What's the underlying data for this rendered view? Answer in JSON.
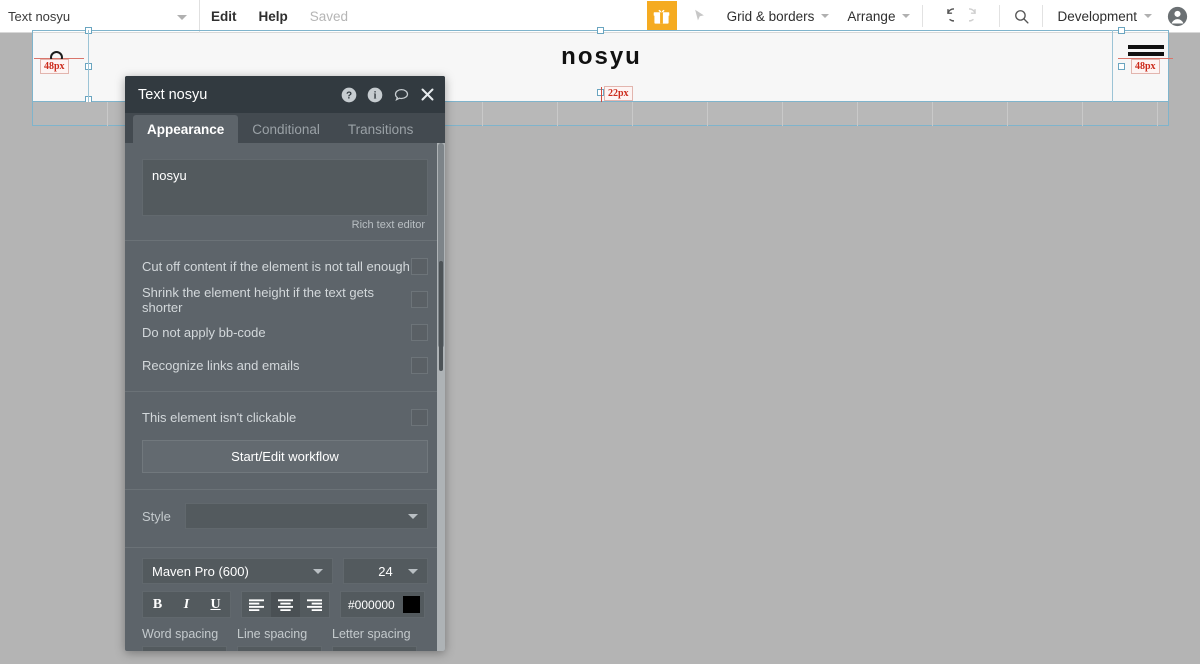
{
  "topbar": {
    "element_selector": {
      "value": "Text nosyu",
      "icon": "chevron-down-icon"
    },
    "menu": [
      {
        "label": "Edit",
        "dim": false
      },
      {
        "label": "Help",
        "dim": false
      },
      {
        "label": "Saved",
        "dim": true
      }
    ],
    "gift_icon": "gift-icon",
    "cursor_icon": "cursor-arrow-icon",
    "grid_borders": {
      "label": "Grid & borders",
      "icon": "chevron-down-icon"
    },
    "arrange": {
      "label": "Arrange",
      "icon": "chevron-down-icon"
    },
    "undo_icon": "undo-icon",
    "redo_icon": "redo-icon",
    "search_icon": "search-icon",
    "version": {
      "label": "Development",
      "icon": "chevron-down-icon"
    },
    "avatar_icon": "user-avatar-icon"
  },
  "canvas": {
    "page_title": "nosyu",
    "measurements": [
      {
        "id": "left",
        "label": "48px"
      },
      {
        "id": "center",
        "label": "22px"
      },
      {
        "id": "right",
        "label": "48px"
      }
    ]
  },
  "panel": {
    "title": "Text nosyu",
    "header_icons": [
      {
        "name": "help-icon",
        "glyph": "?"
      },
      {
        "name": "info-icon",
        "glyph": "i"
      },
      {
        "name": "comment-icon",
        "glyph": "comment"
      },
      {
        "name": "close-icon",
        "glyph": "✕"
      }
    ],
    "tabs": [
      {
        "label": "Appearance",
        "active": true
      },
      {
        "label": "Conditional",
        "active": false
      },
      {
        "label": "Transitions",
        "active": false
      }
    ],
    "rich_text": {
      "value": "nosyu",
      "caption": "Rich text editor"
    },
    "checkboxes": [
      {
        "label": "Cut off content if the element is not tall enough",
        "checked": false
      },
      {
        "label": "Shrink the element height if the text gets shorter",
        "checked": false
      },
      {
        "label": "Do not apply bb-code",
        "checked": false
      },
      {
        "label": "Recognize links and emails",
        "checked": false
      },
      {
        "label": "This element isn't clickable",
        "checked": false
      }
    ],
    "workflow_button": "Start/Edit workflow",
    "style": {
      "label": "Style",
      "value": ""
    },
    "font": {
      "family": "Maven Pro (600)",
      "size": "24"
    },
    "format_buttons": [
      {
        "name": "bold-button",
        "glyph": "B"
      },
      {
        "name": "italic-button",
        "glyph": "I"
      },
      {
        "name": "underline-button",
        "glyph": "U"
      }
    ],
    "align_buttons": [
      {
        "name": "align-left-button",
        "active": false
      },
      {
        "name": "align-center-button",
        "active": true
      },
      {
        "name": "align-right-button",
        "active": false
      }
    ],
    "color": {
      "value": "#000000",
      "swatch": "#000000"
    },
    "spacing": [
      {
        "label": "Word spacing",
        "value": ""
      },
      {
        "label": "Line spacing",
        "value": ""
      },
      {
        "label": "Letter spacing",
        "value": ""
      }
    ]
  },
  "colors": {
    "accent": "#f5ab21",
    "panel_bg": "#5d646a",
    "panel_header": "#323a40",
    "canvas_bg": "#b4b4b4",
    "measure_red": "#cc2b1c",
    "selection_blue": "#7fb4cc"
  }
}
